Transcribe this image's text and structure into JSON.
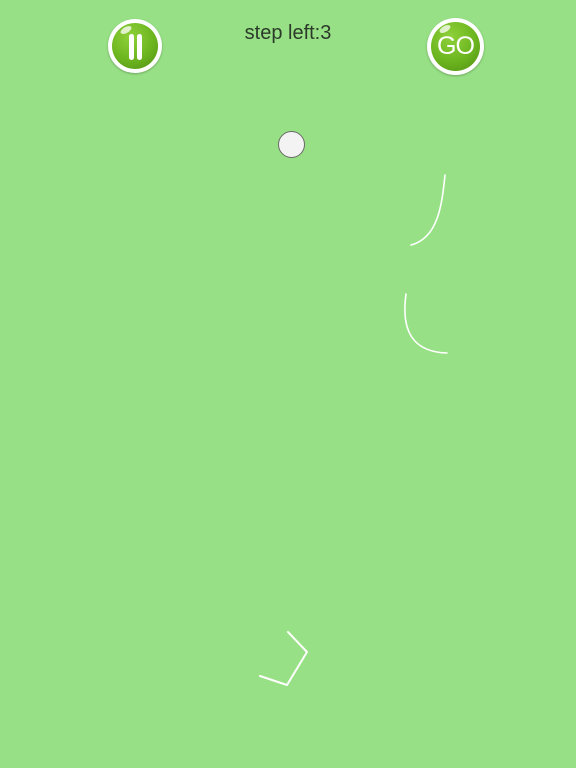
{
  "hud": {
    "step_text": "step left:3",
    "pause_icon": "pause-icon",
    "go_label": "GO"
  },
  "colors": {
    "background": "#97e085",
    "button_green": "#6cb51f",
    "line_white": "#ffffff",
    "ball": "#f3f3f3"
  },
  "drawn_lines_count": 3
}
